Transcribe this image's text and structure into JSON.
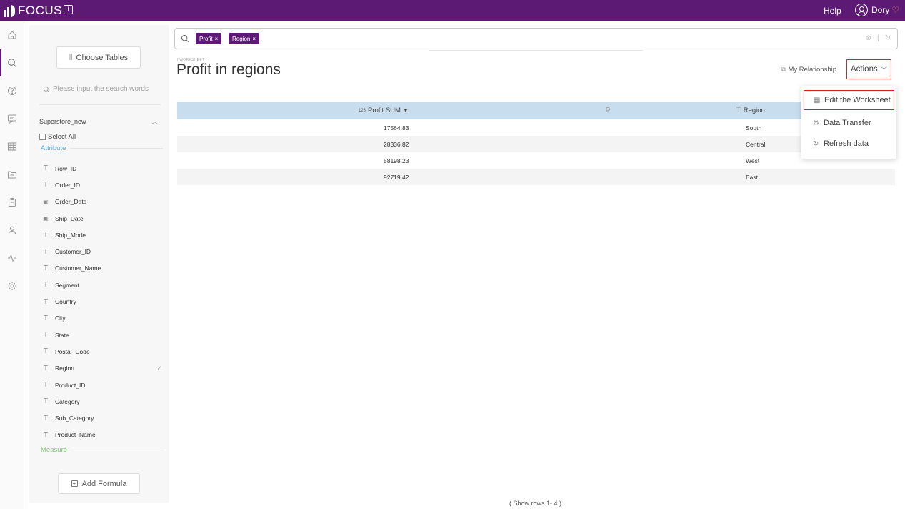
{
  "topbar": {
    "logo_text": "FOCUS",
    "new_tab_symbol": "+",
    "help": "Help",
    "user": "Dory",
    "background": "#5c1a74"
  },
  "rail": {
    "items": [
      "home-icon",
      "search-icon",
      "question-icon",
      "chat-icon",
      "grid-icon",
      "folder-icon",
      "clipboard-icon",
      "user-icon",
      "pulse-icon",
      "settings-icon"
    ],
    "active": "search-icon"
  },
  "sidebar": {
    "choose_tables": "Choose Tables",
    "search_placeholder": "Please input the search words",
    "table_name": "Superstore_new",
    "select_all": "Select All",
    "attribute_label": "Attribute",
    "measure_label": "Measure",
    "fields": [
      {
        "name": "Row_ID",
        "type": "text"
      },
      {
        "name": "Order_ID",
        "type": "text"
      },
      {
        "name": "Order_Date",
        "type": "date"
      },
      {
        "name": "Ship_Date",
        "type": "date"
      },
      {
        "name": "Ship_Mode",
        "type": "text"
      },
      {
        "name": "Customer_ID",
        "type": "text"
      },
      {
        "name": "Customer_Name",
        "type": "text"
      },
      {
        "name": "Segment",
        "type": "text"
      },
      {
        "name": "Country",
        "type": "text"
      },
      {
        "name": "City",
        "type": "text"
      },
      {
        "name": "State",
        "type": "text"
      },
      {
        "name": "Postal_Code",
        "type": "text"
      },
      {
        "name": "Region",
        "type": "text",
        "checked": true
      },
      {
        "name": "Product_ID",
        "type": "text"
      },
      {
        "name": "Category",
        "type": "text"
      },
      {
        "name": "Sub_Category",
        "type": "text"
      },
      {
        "name": "Product_Name",
        "type": "text"
      }
    ],
    "add_formula": "Add Formula"
  },
  "search": {
    "chips": [
      "Profit",
      "Region"
    ]
  },
  "header": {
    "tag": "[ WORKSHEET ]",
    "title": "Profit in regions",
    "my_relationship": "My Relationship",
    "actions": "Actions"
  },
  "table": {
    "columns": [
      "Profit SUM",
      "Region"
    ],
    "sort_indicator": "▼",
    "rows": [
      [
        "17564.83",
        "South"
      ],
      [
        "28336.82",
        "Central"
      ],
      [
        "58198.23",
        "West"
      ],
      [
        "92719.42",
        "East"
      ]
    ],
    "footer": "( Show rows 1- 4 )"
  },
  "actions_menu": {
    "items": [
      {
        "label": "Edit the Worksheet",
        "icon": "table-icon"
      },
      {
        "label": "Data Transfer",
        "icon": "gear-icon"
      },
      {
        "label": "Refresh data",
        "icon": "refresh-icon"
      }
    ]
  },
  "colors": {
    "brand": "#5c1a74",
    "table_header": "#c8dded",
    "highlight_box": "#e02020",
    "attribute": "#5aa8e0",
    "measure": "#77c76b"
  }
}
